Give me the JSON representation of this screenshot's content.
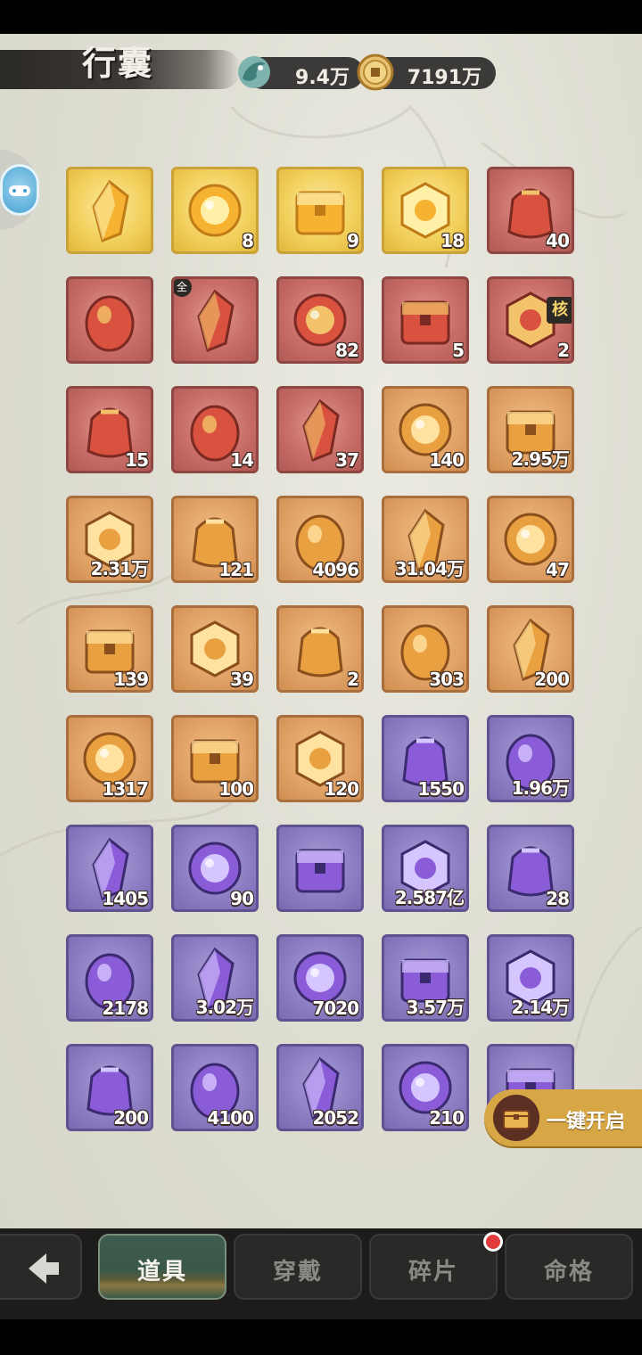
{
  "header": {
    "title": "行囊",
    "currencies": [
      {
        "icon": "jade-fish-icon",
        "value": "9.4万"
      },
      {
        "icon": "copper-coin-icon",
        "value": "7191万"
      }
    ]
  },
  "items": [
    {
      "icon": "crystal-shard-icon",
      "rarity": "gold",
      "count": ""
    },
    {
      "icon": "yin-yang-orb-icon",
      "rarity": "gold",
      "count": "8"
    },
    {
      "icon": "ornate-orb-icon",
      "rarity": "gold",
      "count": "9"
    },
    {
      "icon": "beast-crystal-icon",
      "rarity": "gold",
      "count": "18"
    },
    {
      "icon": "portrait-card-icon",
      "rarity": "red",
      "count": "40"
    },
    {
      "icon": "treasure-box-icon",
      "rarity": "red",
      "count": ""
    },
    {
      "icon": "radish-spirit-icon",
      "rarity": "red",
      "count": "",
      "badge": "全"
    },
    {
      "icon": "token-plaque-icon",
      "rarity": "red",
      "count": "82"
    },
    {
      "icon": "cloth-pouch-icon",
      "rarity": "red",
      "count": "5"
    },
    {
      "icon": "red-giftbox-icon",
      "rarity": "red",
      "count": "2",
      "corner": "核"
    },
    {
      "icon": "pearls-stand-icon",
      "rarity": "red",
      "count": "15"
    },
    {
      "icon": "crystal-ball-icon",
      "rarity": "red",
      "count": "14"
    },
    {
      "icon": "beast-crystal-icon",
      "rarity": "red",
      "count": "37"
    },
    {
      "icon": "golden-claw-icon",
      "rarity": "orange",
      "count": "140"
    },
    {
      "icon": "dragon-coin-icon",
      "rarity": "orange",
      "count": "2.95万"
    },
    {
      "icon": "purple-crystal-icon",
      "rarity": "orange",
      "count": "2.31万"
    },
    {
      "icon": "scroll-banner-icon",
      "rarity": "orange",
      "count": "121"
    },
    {
      "icon": "amber-ore-icon",
      "rarity": "orange",
      "count": "4096"
    },
    {
      "icon": "spirit-flask-icon",
      "rarity": "orange",
      "count": "31.04万"
    },
    {
      "icon": "orange-fruit-icon",
      "rarity": "orange",
      "count": "47"
    },
    {
      "icon": "brush-feather-icon",
      "rarity": "orange",
      "count": "139"
    },
    {
      "icon": "fan-emblem-icon",
      "rarity": "orange",
      "count": "39"
    },
    {
      "icon": "card-chest-icon",
      "rarity": "orange",
      "count": "2"
    },
    {
      "icon": "jade-ring-icon",
      "rarity": "orange",
      "count": "303"
    },
    {
      "icon": "golden-orb-icon",
      "rarity": "orange",
      "count": "200"
    },
    {
      "icon": "mask-gourd-icon",
      "rarity": "orange",
      "count": "1317"
    },
    {
      "icon": "beast-crystal-icon",
      "rarity": "orange",
      "count": "100"
    },
    {
      "icon": "cloth-pouch-icon",
      "rarity": "orange",
      "count": "120"
    },
    {
      "icon": "amethyst-shards-icon",
      "rarity": "purple",
      "count": "1550"
    },
    {
      "icon": "silver-dragon-coin-icon",
      "rarity": "purple",
      "count": "1.96万"
    },
    {
      "icon": "bronze-disc-icon",
      "rarity": "purple",
      "count": "1405"
    },
    {
      "icon": "violet-drop-icon",
      "rarity": "purple",
      "count": "90"
    },
    {
      "icon": "swirl-gem-icon",
      "rarity": "purple",
      "count": ""
    },
    {
      "icon": "red-beads-icon",
      "rarity": "purple",
      "count": "2.587亿"
    },
    {
      "icon": "silk-cloth-icon",
      "rarity": "purple",
      "count": "28"
    },
    {
      "icon": "stone-tablet-icon",
      "rarity": "purple",
      "count": "2178"
    },
    {
      "icon": "taiji-fish-icon",
      "rarity": "purple",
      "count": "3.02万"
    },
    {
      "icon": "golden-leaf-icon",
      "rarity": "purple",
      "count": "7020"
    },
    {
      "icon": "green-orb-icon",
      "rarity": "purple",
      "count": "3.57万"
    },
    {
      "icon": "mask-gourd-icon",
      "rarity": "purple",
      "count": "2.14万"
    },
    {
      "icon": "purple-amulet-icon",
      "rarity": "purple",
      "count": "200"
    },
    {
      "icon": "orb-pedestal-icon",
      "rarity": "purple",
      "count": "4100"
    },
    {
      "icon": "herb-flower-icon",
      "rarity": "purple",
      "count": "2052"
    },
    {
      "icon": "talisman-scroll-icon",
      "rarity": "purple",
      "count": "210"
    },
    {
      "icon": "folded-cloth-icon",
      "rarity": "purple",
      "count": ""
    }
  ],
  "open_all": {
    "label": "一键开启"
  },
  "tabs": [
    {
      "label": "道具",
      "active": true
    },
    {
      "label": "穿戴",
      "active": false
    },
    {
      "label": "碎片",
      "active": false,
      "notification": true
    },
    {
      "label": "命格",
      "active": false
    }
  ]
}
